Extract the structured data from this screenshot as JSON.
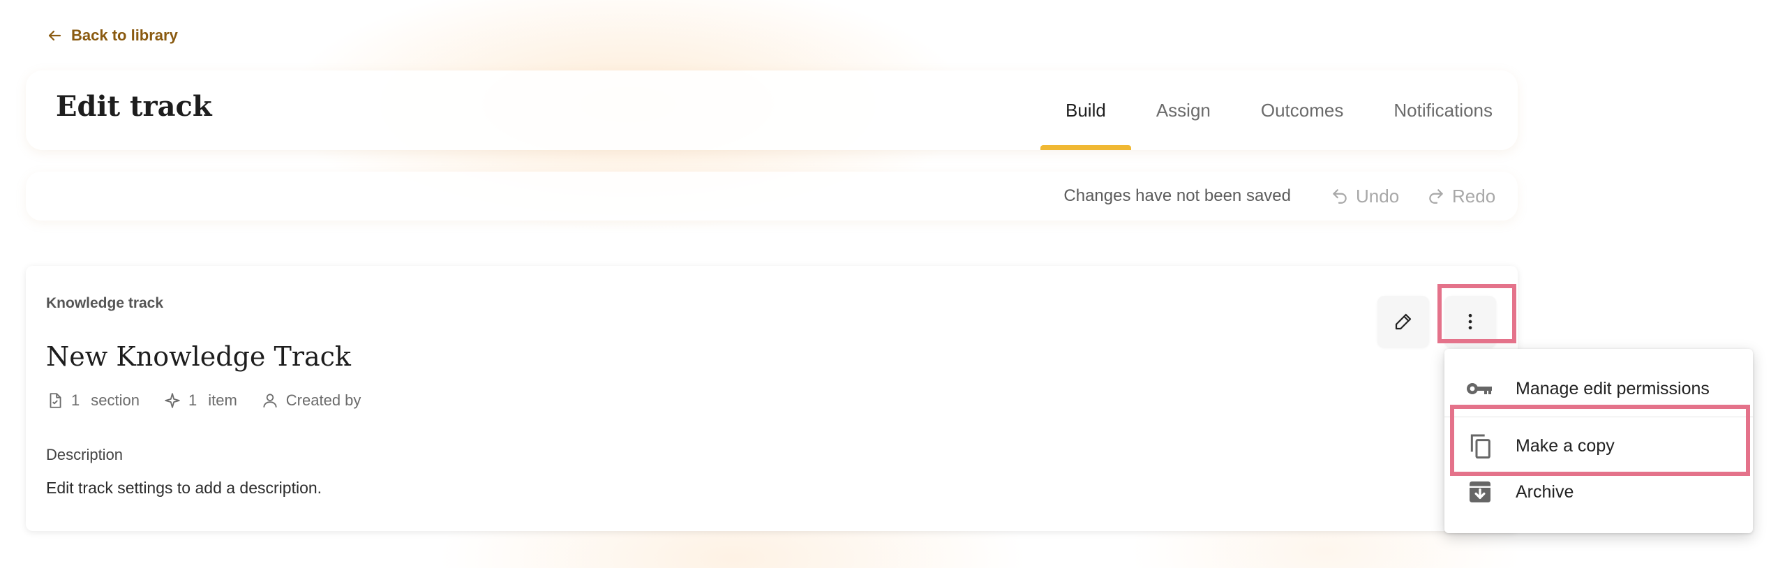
{
  "nav": {
    "back_label": "Back to library"
  },
  "header": {
    "title": "Edit track",
    "tabs": [
      {
        "label": "Build",
        "active": true
      },
      {
        "label": "Assign",
        "active": false
      },
      {
        "label": "Outcomes",
        "active": false
      },
      {
        "label": "Notifications",
        "active": false
      }
    ],
    "accent_color": "#f0b833"
  },
  "save_bar": {
    "status": "Changes have not been saved",
    "undo_label": "Undo",
    "redo_label": "Redo"
  },
  "track": {
    "kicker": "Knowledge track",
    "title": "New Knowledge Track",
    "meta": {
      "sections_count": "1",
      "sections_label": "section",
      "items_count": "1",
      "items_label": "item",
      "created_by_label": "Created by"
    },
    "description_label": "Description",
    "description": "Edit track settings to add a description."
  },
  "menu": {
    "items": [
      {
        "label": "Manage edit permissions",
        "icon": "key-icon"
      },
      {
        "label": "Make a copy",
        "icon": "copy-icon"
      },
      {
        "label": "Archive",
        "icon": "archive-icon"
      }
    ]
  },
  "highlight_color": "#e4728a"
}
